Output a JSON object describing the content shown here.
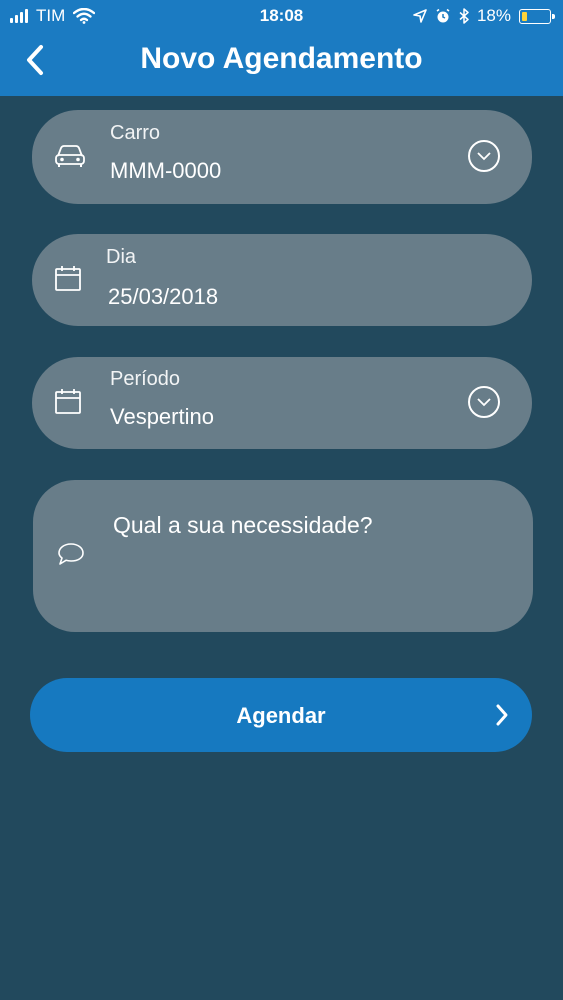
{
  "status_bar": {
    "carrier": "TIM",
    "time": "18:08",
    "battery": "18%",
    "battery_level": 0.18,
    "icons": [
      "signal-icon",
      "wifi-icon",
      "location-icon",
      "alarm-icon",
      "bluetooth-icon",
      "battery-icon"
    ]
  },
  "header": {
    "title": "Novo Agendamento",
    "back_icon": "chevron-left-icon",
    "background": "#1b7bc2"
  },
  "form": {
    "carro": {
      "label": "Carro",
      "value": "MMM-0000",
      "icon": "car-icon",
      "action_icon": "chevron-down-circle-icon"
    },
    "dia": {
      "label": "Dia",
      "value": "25/03/2018",
      "icon": "calendar-icon"
    },
    "periodo": {
      "label": "Período",
      "value": "Vespertino",
      "icon": "calendar-icon",
      "action_icon": "chevron-down-circle-icon"
    },
    "necessidade": {
      "placeholder": "Qual a sua necessidade?",
      "icon": "chat-bubble-icon"
    }
  },
  "submit": {
    "label": "Agendar",
    "icon": "chevron-right-icon",
    "color": "#1679c0"
  },
  "colors": {
    "background": "#22495d",
    "field": "#687d89"
  }
}
